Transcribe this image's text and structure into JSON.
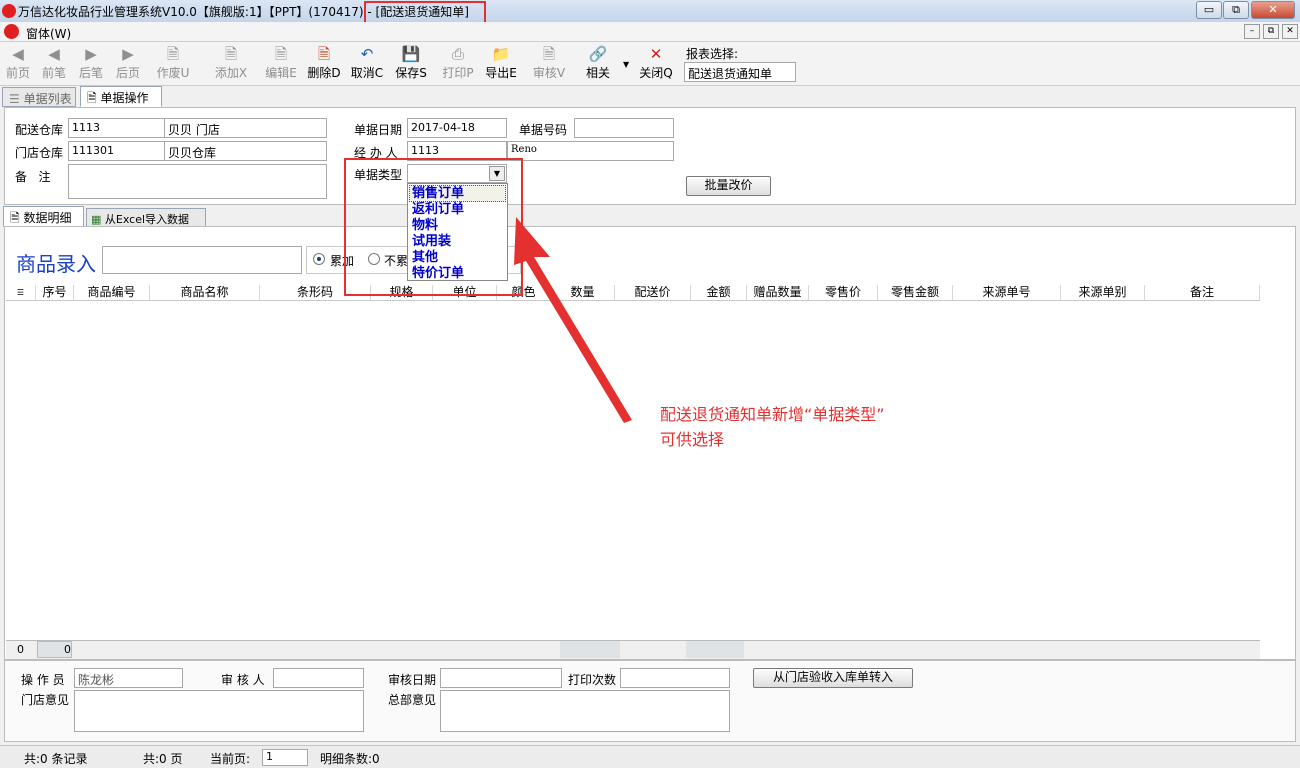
{
  "window": {
    "title": "万信达化妆品行业管理系统V10.0【旗舰版:1】【PPT】(170417) - [配送退货通知单]",
    "min": "▭",
    "max": "⧉",
    "close": "✕"
  },
  "menu": {
    "window_label": "窗体(W)",
    "mdi_min": "–",
    "mdi_restore": "⧉",
    "mdi_close": "✕"
  },
  "toolbar": {
    "buttons": [
      {
        "label": "前页",
        "icon": "◀"
      },
      {
        "label": "前笔",
        "icon": "◀"
      },
      {
        "label": "后笔",
        "icon": "▶"
      },
      {
        "label": "后页",
        "icon": "▶"
      },
      {
        "label": "作废U",
        "icon": "🗎"
      },
      {
        "label": "添加X",
        "icon": "🗎"
      },
      {
        "label": "编辑E",
        "icon": "🗎"
      },
      {
        "label": "删除D",
        "icon": "🗎"
      },
      {
        "label": "取消C",
        "icon": "↶"
      },
      {
        "label": "保存S",
        "icon": "💾"
      },
      {
        "label": "打印P",
        "icon": "⎙"
      },
      {
        "label": "导出E",
        "icon": "📁"
      },
      {
        "label": "审核V",
        "icon": "🗎"
      },
      {
        "label": "相关",
        "icon": "🔗"
      },
      {
        "label": "关闭Q",
        "icon": "✕"
      }
    ],
    "report_label": "报表选择:",
    "report_value": "配送退货通知单"
  },
  "tabs": {
    "list": "单据列表",
    "operate": "单据操作"
  },
  "form": {
    "warehouse_label": "配送仓库",
    "warehouse_code": "1113",
    "warehouse_name": "贝贝 门店",
    "store_label": "门店仓库",
    "store_code": "111301",
    "store_name": "贝贝仓库",
    "remark_label": "备   注",
    "date_label": "单据日期",
    "date_value": "2017-04-18",
    "docno_label": "单据号码",
    "docno_value": "",
    "handler_label": "经 办 人",
    "handler_code": "1113",
    "handler_name": "Reno",
    "doctype_label": "单据类型",
    "doctype_value": "",
    "batch_button": "批量改价"
  },
  "doctype_options": [
    "销售订单",
    "返利订单",
    "物料",
    "试用装",
    "其他",
    "特价订单"
  ],
  "subtabs": {
    "detail": "数据明细",
    "excel": "从Excel导入数据"
  },
  "entry": {
    "label": "商品录入",
    "radio_add": "累加",
    "radio_noadd": "不累加"
  },
  "grid": {
    "columns": [
      "序号",
      "商品编号",
      "商品名称",
      "条形码",
      "规格",
      "单位",
      "颜色",
      "数量",
      "配送价",
      "金额",
      "赠品数量",
      "零售价",
      "零售金额",
      "来源单号",
      "来源单别",
      "备注"
    ],
    "footer_count": "0",
    "footer_sum": "0"
  },
  "bottom": {
    "operator_label": "操 作 员",
    "operator_value": "陈龙彬",
    "auditor_label": "审 核 人",
    "auditor_value": "",
    "auditdate_label": "审核日期",
    "auditdate_value": "",
    "printcount_label": "打印次数",
    "printcount_value": "",
    "transfer_button": "从门店验收入库单转入",
    "store_opinion_label": "门店意见",
    "hq_opinion_label": "总部意见"
  },
  "annotation": {
    "line1": "配送退货通知单新增“单据类型”",
    "line2": "可供选择"
  },
  "status": {
    "records": "共:0 条记录",
    "pages": "共:0 页",
    "current_label": "当前页:",
    "current_value": "1",
    "detail_count": "明细条数:0"
  }
}
